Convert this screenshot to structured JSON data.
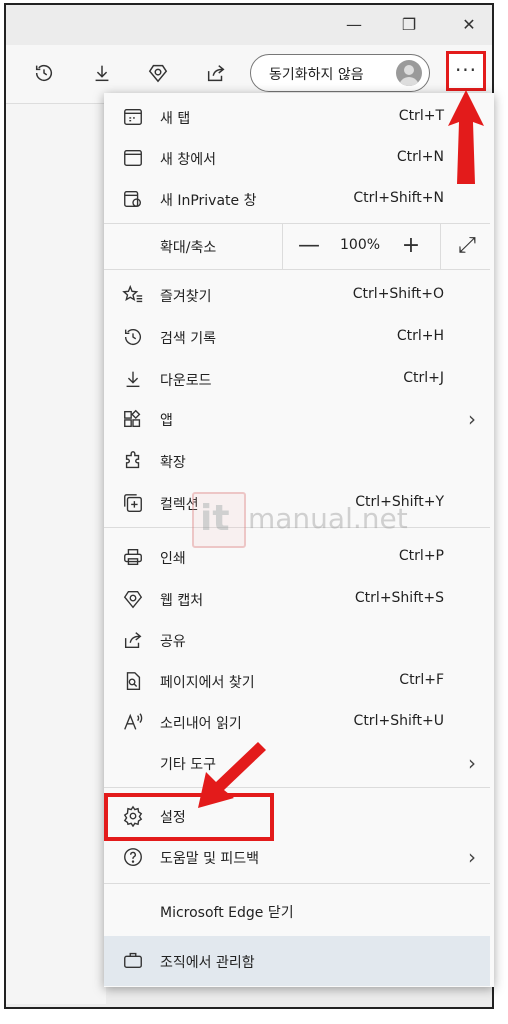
{
  "window": {
    "minimize": "—",
    "restore": "❐",
    "close": "✕"
  },
  "toolbar": {
    "sync_label": "동기화하지 않음",
    "more_label": "···"
  },
  "menu": {
    "items_a": [
      {
        "label": "새 탭",
        "shortcut": "Ctrl+T",
        "icon": "new-tab-icon"
      },
      {
        "label": "새 창에서",
        "shortcut": "Ctrl+N",
        "icon": "new-window-icon"
      },
      {
        "label": "새 InPrivate 창",
        "shortcut": "Ctrl+Shift+N",
        "icon": "inprivate-icon"
      }
    ],
    "zoom": {
      "label": "확대/축소",
      "minus": "—",
      "value": "100%",
      "plus": "+",
      "fullscreen": "⤢"
    },
    "items_b": [
      {
        "label": "즐겨찾기",
        "shortcut": "Ctrl+Shift+O",
        "icon": "favorites-icon"
      },
      {
        "label": "검색 기록",
        "shortcut": "Ctrl+H",
        "icon": "history-icon"
      },
      {
        "label": "다운로드",
        "shortcut": "Ctrl+J",
        "icon": "download-icon"
      },
      {
        "label": "앱",
        "shortcut": "",
        "icon": "apps-icon",
        "chevron": "›"
      },
      {
        "label": "확장",
        "shortcut": "",
        "icon": "extensions-icon"
      },
      {
        "label": "컬렉션",
        "shortcut": "Ctrl+Shift+Y",
        "icon": "collections-icon"
      }
    ],
    "items_c": [
      {
        "label": "인쇄",
        "shortcut": "Ctrl+P",
        "icon": "print-icon"
      },
      {
        "label": "웹 캡처",
        "shortcut": "Ctrl+Shift+S",
        "icon": "web-capture-icon"
      },
      {
        "label": "공유",
        "shortcut": "",
        "icon": "share-icon"
      },
      {
        "label": "페이지에서 찾기",
        "shortcut": "Ctrl+F",
        "icon": "find-icon"
      },
      {
        "label": "소리내어 읽기",
        "shortcut": "Ctrl+Shift+U",
        "icon": "read-aloud-icon"
      },
      {
        "label": "기타 도구",
        "shortcut": "",
        "icon": "",
        "chevron": "›"
      }
    ],
    "items_d": [
      {
        "label": "설정",
        "shortcut": "",
        "icon": "gear-icon"
      },
      {
        "label": "도움말 및 피드백",
        "shortcut": "",
        "icon": "help-icon",
        "chevron": "›"
      }
    ],
    "close_label": "Microsoft Edge 닫기",
    "manage_label": "조직에서 관리함"
  },
  "watermark": {
    "mark": "it",
    "text": "manual.net"
  },
  "colors": {
    "highlight": "#e31b1b",
    "menu_bg": "#f9f9f9",
    "managed_bg": "#e2e8ee"
  }
}
